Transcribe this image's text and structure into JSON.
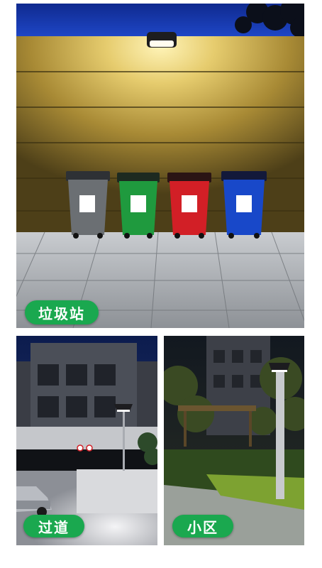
{
  "scenes": [
    {
      "label": "垃圾站"
    },
    {
      "label": "过道"
    },
    {
      "label": "小区"
    }
  ],
  "colors": {
    "badge": "#1aa84f",
    "bin_gray": "#6b6f73",
    "bin_green": "#1f9a3e",
    "bin_red": "#d21f26",
    "bin_blue": "#1848c9"
  }
}
